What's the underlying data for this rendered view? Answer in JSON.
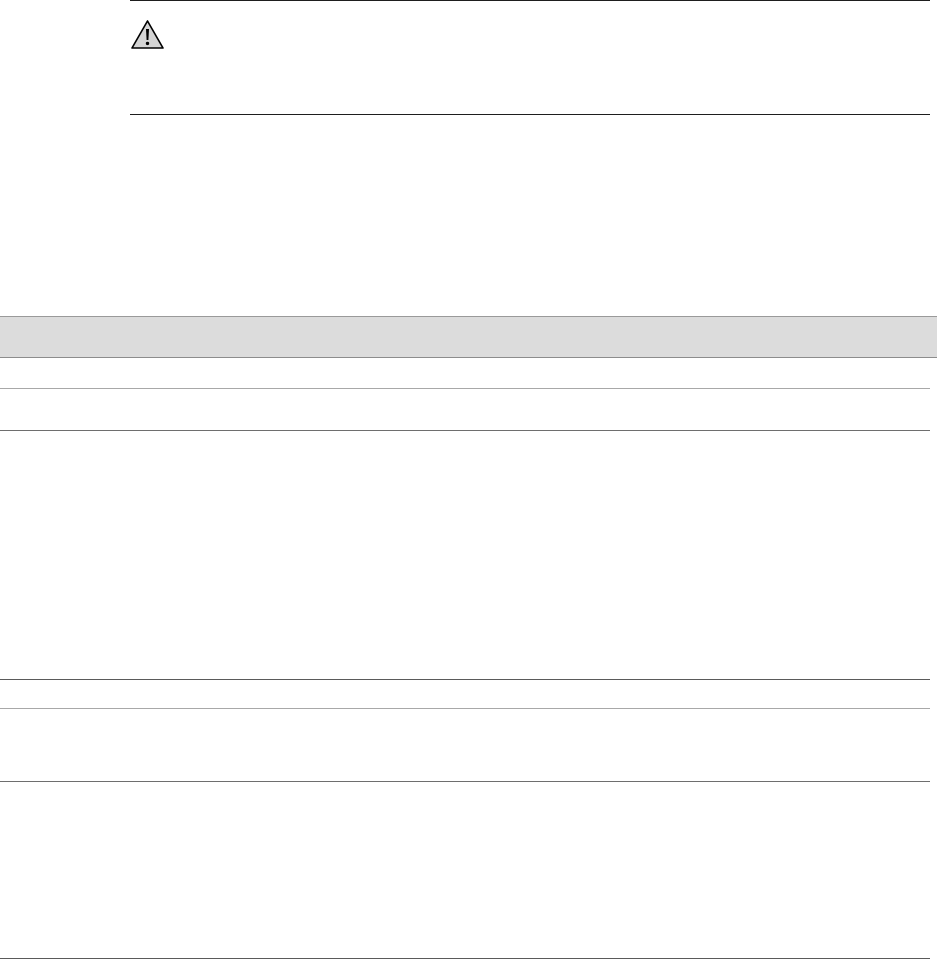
{
  "caution": {
    "icon": "caution-icon"
  },
  "colors": {
    "header_bg": "#dcdcdc",
    "rule_dark": "#5a5a5a",
    "rule_light": "#a8a8a8",
    "icon_fill": "#d4d4d4",
    "icon_stroke": "#000000"
  }
}
